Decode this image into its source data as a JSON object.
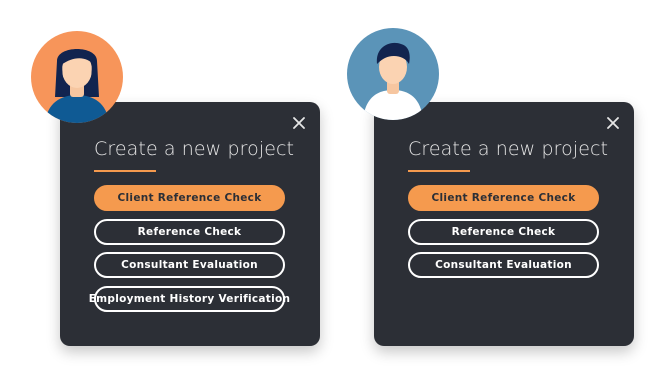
{
  "dialogs": [
    {
      "title": "Create a new project",
      "options": [
        "Client Reference Check",
        "Reference Check",
        "Consultant Evaluation",
        "Employment History Verification"
      ],
      "selected_option": "Client Reference Check"
    },
    {
      "title": "Create a new project",
      "options": [
        "Client Reference Check",
        "Reference Check",
        "Consultant Evaluation"
      ],
      "selected_option": "Client Reference Check"
    }
  ],
  "icons": {
    "close": "close-icon",
    "avatar_left": "female-avatar",
    "avatar_right": "male-avatar"
  },
  "colors": {
    "dialog_bg": "#2c2f36",
    "accent": "#f59a4e",
    "avatar_left_bg": "#f7955a",
    "avatar_right_bg": "#5b94b8",
    "hair": "#12244f",
    "shirt_left": "#0f5a94"
  }
}
